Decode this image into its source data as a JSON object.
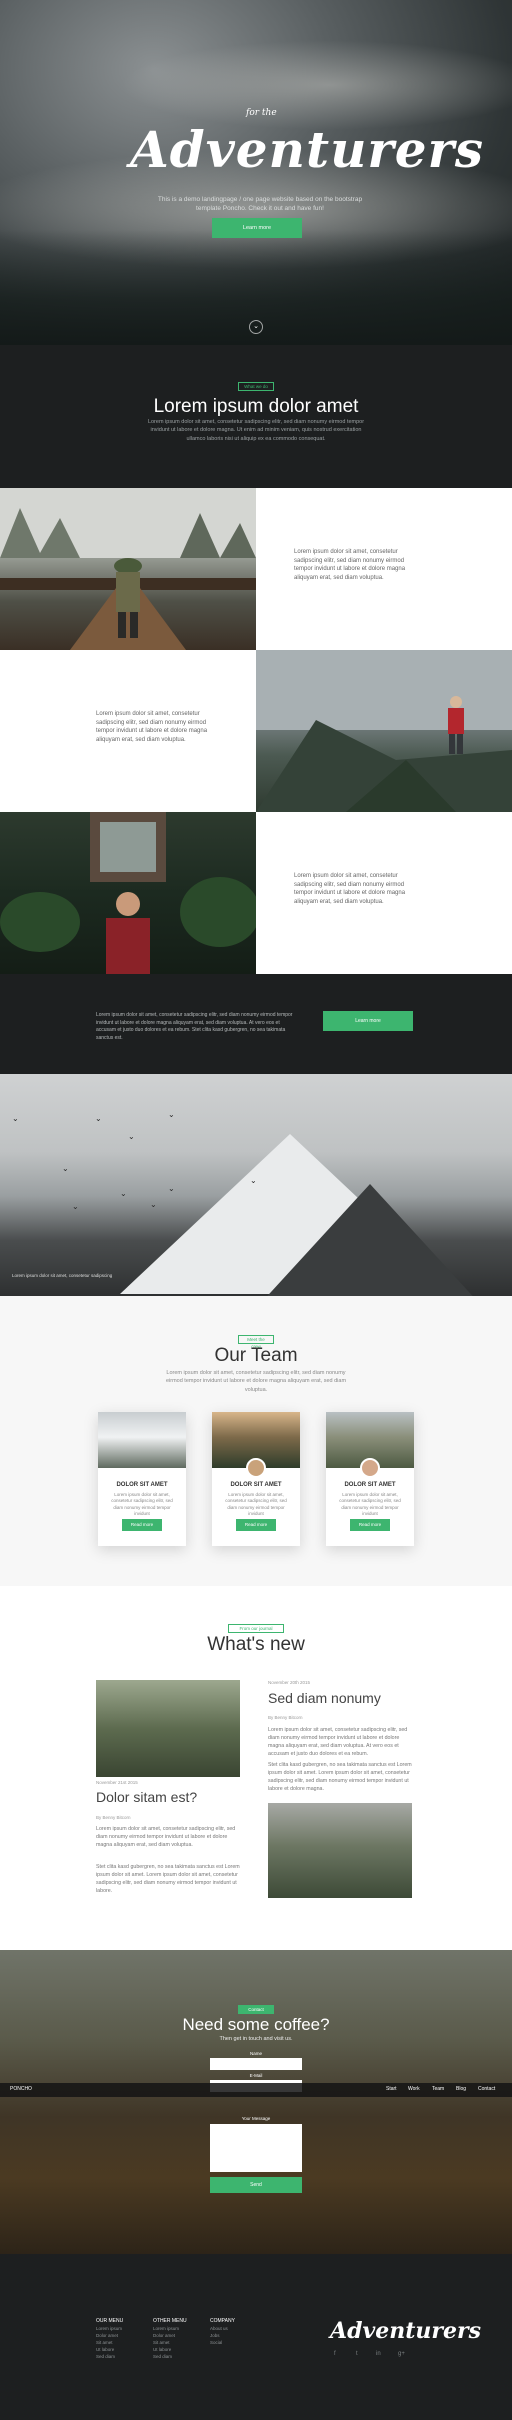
{
  "hero": {
    "for_the": "for the",
    "title": "Adventurers",
    "subtitle": "This is a demo landingpage / one page website based on the bootstrap template Poncho. Check it out and have fun!",
    "cta": "Learn more",
    "scroll": "⌄"
  },
  "intro": {
    "tag": "What we do",
    "title": "Lorem ipsum dolor amet",
    "text": "Lorem ipsum dolor sit amet, consetetur sadipscing elitr, sed diam nonumy eirmod tempor invidunt ut labore et dolore magna. Ut enim ad minim veniam, quis nostrud exercitation ullamco laboris nisi ut aliquip ex ea commodo consequat."
  },
  "features": {
    "item1": "Lorem ipsum dolor sit amet, consetetur sadipscing elitr, sed diam nonumy eirmod tempor invidunt ut labore et dolore magna aliquyam erat, sed diam voluptua.",
    "item2": "Lorem ipsum dolor sit amet, consetetur sadipscing elitr, sed diam nonumy eirmod tempor invidunt ut labore et dolore magna aliquyam erat, sed diam voluptua.",
    "item3": "Lorem ipsum dolor sit amet, consetetur sadipscing elitr, sed diam nonumy eirmod tempor invidunt ut labore et dolore magna aliquyam erat, sed diam voluptua."
  },
  "cta": {
    "text": "Lorem ipsum dolor sit amet, consetetur sadipscing elitr, sed diam nonumy eirmod tempor invidunt ut labore et dolore magna aliquyam erat, sed diam voluptua. At vero eos et accusam et justo duo dolores et ea rebum. Stet clita kasd gubergren, no sea takimata sanctus est.",
    "button": "Learn more"
  },
  "mountain": {
    "caption": "Lorem ipsum dolor sit amet, consetetur sadipscing"
  },
  "team": {
    "tag": "Meet the crew",
    "title": "Our Team",
    "intro": "Lorem ipsum dolor sit amet, consetetur sadipscing elitr, sed diam nonumy eirmod tempor invidunt ut labore et dolore magna aliquyam erat, sed diam voluptua.",
    "members": [
      {
        "name": "DOLOR SIT AMET",
        "desc": "Lorem ipsum dolor sit amet, consetetur sadipscing elitr, sed diam nonumy eirmod tempor invidunt",
        "button": "Read more"
      },
      {
        "name": "DOLOR SIT AMET",
        "desc": "Lorem ipsum dolor sit amet, consetetur sadipscing elitr, sed diam nonumy eirmod tempor invidunt",
        "button": "Read more"
      },
      {
        "name": "DOLOR SIT AMET",
        "desc": "Lorem ipsum dolor sit amet, consetetur sadipscing elitr, sed diam nonumy eirmod tempor invidunt",
        "button": "Read more"
      }
    ]
  },
  "news": {
    "tag": "From our journal",
    "title": "What's new",
    "post1": {
      "date": "November 21st 2015",
      "title": "Dolor sitam est?",
      "author": "By Benny Bitcorn",
      "text": "Lorem ipsum dolor sit amet, consetetur sadipscing elitr, sed diam nonumy eirmod tempor invidunt ut labore et dolore magna aliquyam erat, sed diam voluptua.",
      "text2": "Stet clita kasd gubergren, no sea takimata sanctus est Lorem ipsum dolor sit amet. Lorem ipsum dolor sit amet, consetetur sadipscing elitr, sed diam nonumy eirmod tempor invidunt ut labore."
    },
    "post2": {
      "date": "November 20th 2015",
      "title": "Sed diam nonumy",
      "author": "By Benny Bitcorn",
      "text": "Lorem ipsum dolor sit amet, consetetur sadipscing elitr, sed diam nonumy eirmod tempor invidunt ut labore et dolore magna aliquyam erat, sed diam voluptua. At vero eos et accusam et justo duo dolores et ea rebum.",
      "text2": "Stet clita kasd gubergren, no sea takimata sanctus est Lorem ipsum dolor sit amet. Lorem ipsum dolor sit amet, consetetur sadipscing elitr, sed diam nonumy eirmod tempor invidunt ut labore et dolore magna."
    }
  },
  "contact": {
    "tag": "Contact",
    "title": "Need some coffee?",
    "subtitle": "Then get in touch and visit us.",
    "name_label": "Name",
    "email_label": "E-Mail",
    "message_label": "Your Message",
    "send": "Send"
  },
  "nav": {
    "brand": "PONCHO",
    "items": [
      "Start",
      "Work",
      "Team",
      "Blog",
      "Contact"
    ]
  },
  "footer": {
    "col1": {
      "head": "OUR MENU",
      "links": [
        "Lorem ipsum",
        "Dolor amet",
        "Sit amet",
        "Ut labore",
        "Sed diam"
      ]
    },
    "col2": {
      "head": "OTHER MENU",
      "links": [
        "Lorem ipsum",
        "Dolor amet",
        "Sit amet",
        "Ut labore",
        "Sed diam"
      ]
    },
    "col3": {
      "head": "COMPANY",
      "links": [
        "About us",
        "Jobs",
        "Social"
      ]
    },
    "logo": "Adventurers",
    "social": [
      "f",
      "t",
      "in",
      "g+"
    ]
  },
  "colors": {
    "accent": "#3db56f",
    "dark": "#1d1f20"
  }
}
